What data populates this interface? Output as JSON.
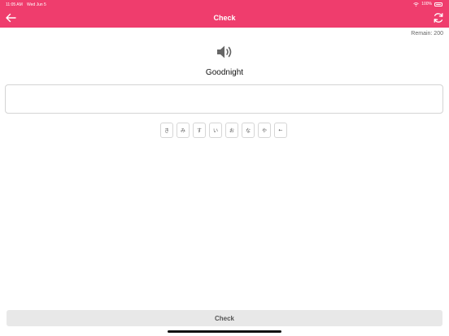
{
  "status_bar": {
    "time": "11:05 AM",
    "date": "Wed Jun 5",
    "battery": "100%"
  },
  "header": {
    "title": "Check",
    "back_icon": "arrow-left-icon",
    "refresh_icon": "refresh-icon",
    "accent_color": "#ef3d6d"
  },
  "quiz": {
    "remain_text": "Remain: 200",
    "speaker_icon": "speaker-icon",
    "word": "Goodnight",
    "answer_value": "",
    "answer_placeholder": ""
  },
  "keyboard": {
    "keys": [
      "き",
      "み",
      "す",
      "い",
      "お",
      "な",
      "や",
      "←"
    ]
  },
  "footer": {
    "check_label": "Check"
  }
}
